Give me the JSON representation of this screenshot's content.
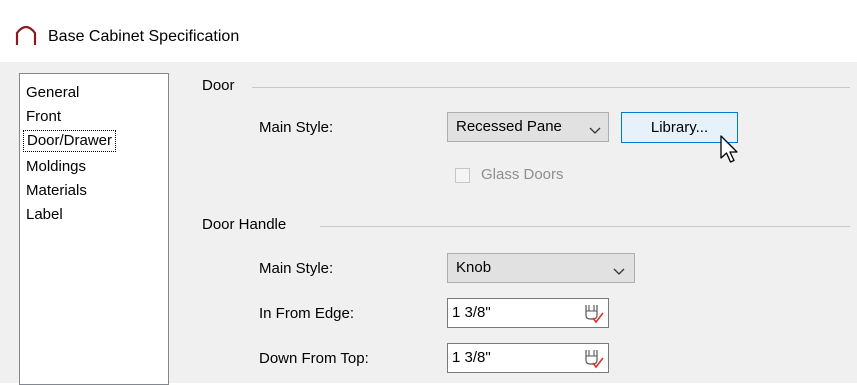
{
  "window": {
    "title": "Base Cabinet Specification",
    "icon": "arch-icon"
  },
  "nav": {
    "items": [
      "General",
      "Front",
      "Door/Drawer",
      "Moldings",
      "Materials",
      "Label"
    ],
    "selected": "Door/Drawer"
  },
  "door": {
    "group_label": "Door",
    "main_style_label": "Main Style:",
    "main_style_value": "Recessed Pane",
    "library_button": "Library...",
    "glass_doors_label": "Glass Doors",
    "glass_doors_checked": false,
    "glass_doors_enabled": false
  },
  "door_handle": {
    "group_label": "Door Handle",
    "main_style_label": "Main Style:",
    "main_style_value": "Knob",
    "in_from_edge_label": "In From Edge:",
    "in_from_edge_value": "1 3/8\"",
    "down_from_top_label": "Down From Top:",
    "down_from_top_value": "1 3/8\""
  },
  "colors": {
    "accent": "#0078d7",
    "dialog_bg": "#f0f0f0",
    "edit_icon": "#d9312b"
  }
}
